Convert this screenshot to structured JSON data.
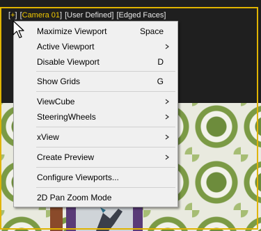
{
  "viewport_label": {
    "plus": "+",
    "camera": "Camera 01",
    "mode": "User Defined",
    "shading": "Edged Faces"
  },
  "colors": {
    "active_border": "#e0b400",
    "label_highlight": "#f0c800",
    "menu_background": "#f0f0f0"
  },
  "menu": {
    "maximize": {
      "label": "Maximize Viewport",
      "shortcut": "Space"
    },
    "active": {
      "label": "Active Viewport",
      "icon": "chevron-right-icon"
    },
    "disable": {
      "label": "Disable Viewport",
      "shortcut": "D"
    },
    "grids": {
      "label": "Show Grids",
      "shortcut": "G"
    },
    "viewcube": {
      "label": "ViewCube",
      "icon": "chevron-right-icon"
    },
    "steering": {
      "label": "SteeringWheels",
      "icon": "chevron-right-icon"
    },
    "xview": {
      "label": "xView",
      "icon": "chevron-right-icon"
    },
    "preview": {
      "label": "Create Preview",
      "icon": "chevron-right-icon"
    },
    "configure": {
      "label": "Configure Viewports..."
    },
    "panzoom": {
      "label": "2D Pan Zoom Mode"
    }
  }
}
